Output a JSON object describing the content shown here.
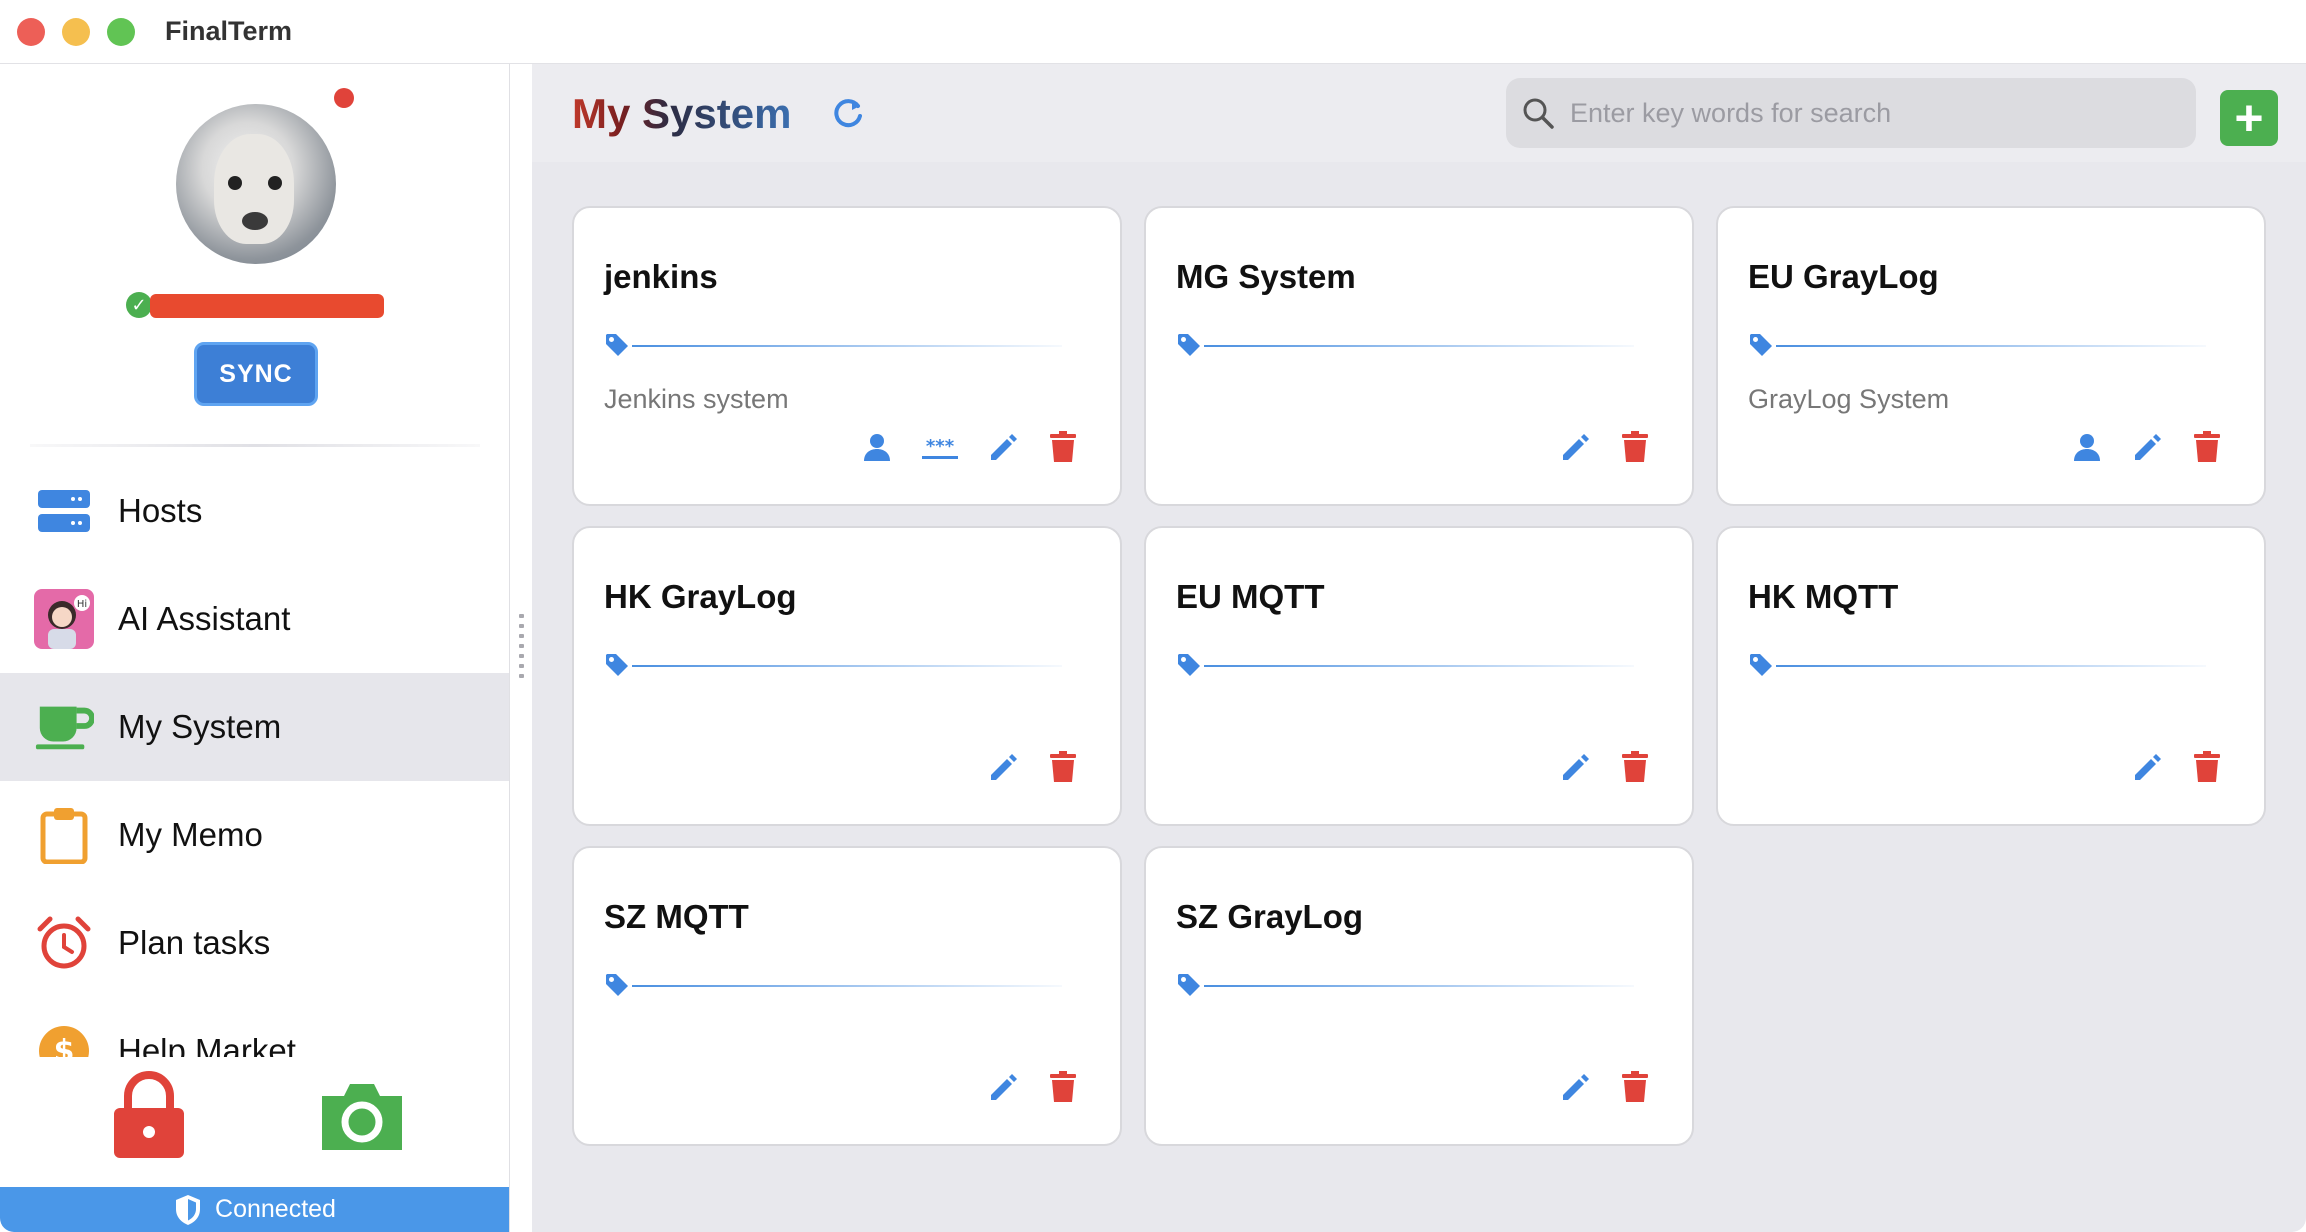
{
  "app": {
    "title": "FinalTerm"
  },
  "sidebar": {
    "sync_label": "SYNC",
    "items": [
      {
        "label": "Hosts",
        "icon": "server-icon"
      },
      {
        "label": "AI Assistant",
        "icon": "ai-assistant-avatar-icon"
      },
      {
        "label": "My System",
        "icon": "coffee-cup-icon",
        "active": true
      },
      {
        "label": "My Memo",
        "icon": "clipboard-icon"
      },
      {
        "label": "Plan tasks",
        "icon": "alarm-clock-icon"
      },
      {
        "label": "Help Market",
        "icon": "dollar-coin-icon"
      }
    ],
    "status": "Connected"
  },
  "main": {
    "title_part1": "My",
    "title_part2": "System",
    "search_placeholder": "Enter key words for search",
    "add_label": "+",
    "cards": [
      {
        "title": "jenkins",
        "description": "Jenkins system",
        "actions": [
          "user",
          "password",
          "edit",
          "delete"
        ]
      },
      {
        "title": "MG System",
        "description": "",
        "actions": [
          "edit",
          "delete"
        ]
      },
      {
        "title": "EU GrayLog",
        "description": "GrayLog System",
        "actions": [
          "user",
          "edit",
          "delete"
        ]
      },
      {
        "title": "HK GrayLog",
        "description": "",
        "actions": [
          "edit",
          "delete"
        ]
      },
      {
        "title": "EU MQTT",
        "description": "",
        "actions": [
          "edit",
          "delete"
        ]
      },
      {
        "title": "HK MQTT",
        "description": "",
        "actions": [
          "edit",
          "delete"
        ]
      },
      {
        "title": "SZ MQTT",
        "description": "",
        "actions": [
          "edit",
          "delete"
        ]
      },
      {
        "title": "SZ GrayLog",
        "description": "",
        "actions": [
          "edit",
          "delete"
        ]
      }
    ]
  },
  "colors": {
    "accent_blue": "#4a8fe0",
    "delete_red": "#e0433a",
    "add_green": "#4caf50",
    "status_blue": "#4a97e8"
  }
}
